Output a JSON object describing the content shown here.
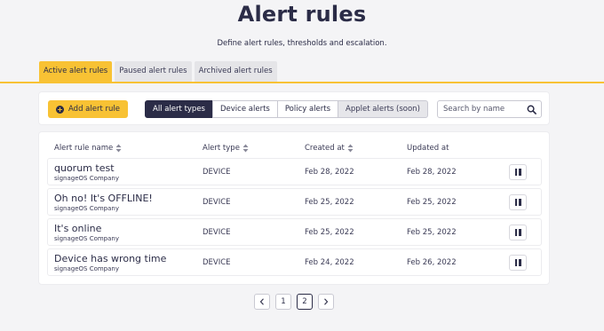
{
  "header": {
    "title": "Alert rules",
    "subtitle": "Define alert rules, thresholds and escalation."
  },
  "tabs": [
    {
      "label": "Active alert rules",
      "active": true
    },
    {
      "label": "Paused alert rules",
      "active": false
    },
    {
      "label": "Archived alert rules",
      "active": false
    }
  ],
  "toolbar": {
    "add_label": "Add alert rule",
    "filters": [
      {
        "label": "All alert types",
        "state": "selected"
      },
      {
        "label": "Device alerts",
        "state": "normal"
      },
      {
        "label": "Policy alerts",
        "state": "normal"
      },
      {
        "label": "Applet alerts (soon)",
        "state": "disabled"
      }
    ],
    "search_placeholder": "Search by name"
  },
  "table": {
    "columns": [
      "Alert rule name",
      "Alert type",
      "Created at",
      "Updated at"
    ],
    "rows": [
      {
        "name": "quorum test",
        "company": "signageOS Company",
        "type": "DEVICE",
        "created": "Feb 28, 2022",
        "updated": "Feb 28, 2022"
      },
      {
        "name": "Oh no! It's OFFLINE!",
        "company": "signageOS Company",
        "type": "DEVICE",
        "created": "Feb 25, 2022",
        "updated": "Feb 25, 2022"
      },
      {
        "name": "It's online",
        "company": "signageOS Company",
        "type": "DEVICE",
        "created": "Feb 25, 2022",
        "updated": "Feb 25, 2022"
      },
      {
        "name": "Device has wrong time",
        "company": "signageOS Company",
        "type": "DEVICE",
        "created": "Feb 24, 2022",
        "updated": "Feb 26, 2022"
      }
    ]
  },
  "pagination": {
    "pages": [
      "1",
      "2"
    ],
    "current": "2"
  },
  "colors": {
    "accent": "#f8c234",
    "primary": "#2b2c47",
    "background": "#f4f4f6"
  }
}
